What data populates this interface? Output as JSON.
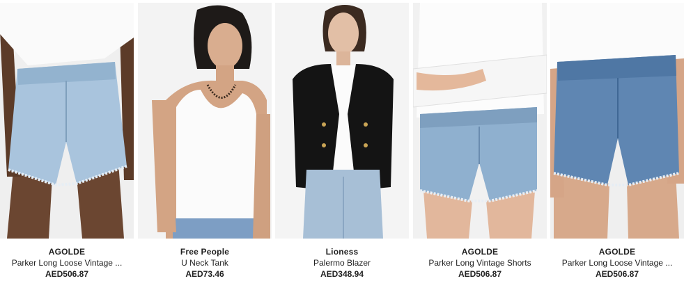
{
  "products": [
    {
      "brand": "AGOLDE",
      "name": "Parker Long Loose Vintage ...",
      "price": "AED506.87",
      "image": "model-in-light-wash-denim-shorts"
    },
    {
      "brand": "Free People",
      "name": "U Neck Tank",
      "price": "AED73.46",
      "image": "model-in-white-tank"
    },
    {
      "brand": "Lioness",
      "name": "Palermo Blazer",
      "price": "AED348.94",
      "image": "model-in-black-blazer"
    },
    {
      "brand": "AGOLDE",
      "name": "Parker Long Vintage Shorts",
      "price": "AED506.87",
      "image": "model-in-denim-shorts"
    },
    {
      "brand": "AGOLDE",
      "name": "Parker Long Loose Vintage ...",
      "price": "AED506.87",
      "image": "model-in-mid-wash-denim-shorts"
    }
  ]
}
